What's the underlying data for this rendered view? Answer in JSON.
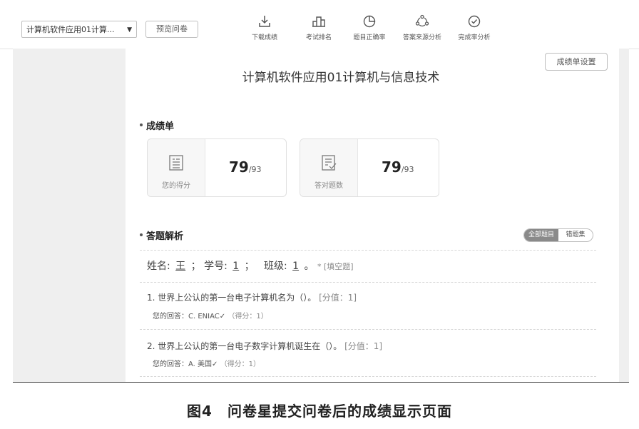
{
  "toolbar": {
    "select_value": "计算机软件应用01计算...",
    "preview_label": "预览问卷",
    "tools": [
      {
        "label": "下载成绩",
        "icon": "download-icon"
      },
      {
        "label": "考试排名",
        "icon": "ranking-icon"
      },
      {
        "label": "题目正确率",
        "icon": "pie-chart-icon"
      },
      {
        "label": "答案来源分析",
        "icon": "source-analysis-icon"
      },
      {
        "label": "完成率分析",
        "icon": "check-circle-icon"
      }
    ]
  },
  "settings_label": "成绩单设置",
  "page_title": "计算机软件应用01计算机与信息技术",
  "report": {
    "section_title": "成绩单",
    "cards": [
      {
        "label": "您的得分",
        "score": "79",
        "total": "/93",
        "icon": "score-sheet-icon"
      },
      {
        "label": "答对题数",
        "score": "79",
        "total": "/93",
        "icon": "correct-list-icon"
      }
    ]
  },
  "analysis": {
    "section_title": "答题解析",
    "toggle_all": "全部题目",
    "toggle_wrong": "错题集",
    "info": {
      "name_label": "姓名:",
      "name_value": "王",
      "sep1": "；",
      "id_label": "学号:",
      "id_value": "1",
      "sep2": "；",
      "class_label": "班级:",
      "class_value": "1",
      "end": "。",
      "tag": "* [填空题]"
    },
    "questions": [
      {
        "title": "1. 世界上公认的第一台电子计算机名为（）。",
        "value": "[分值：1]",
        "answer_label": "您的回答：",
        "answer": "C. ENIAC",
        "check": "✓",
        "score": "（得分：1）"
      },
      {
        "title": "2. 世界上公认的第一台电子数字计算机诞生在（）。",
        "value": "[分值：1]",
        "answer_label": "您的回答：",
        "answer": "A. 美国",
        "check": "✓",
        "score": "（得分：1）"
      }
    ]
  },
  "caption": "图4　问卷星提交问卷后的成绩显示页面",
  "colors": {
    "toggle_active": "#8a8a8a",
    "gutter": "#efefef"
  }
}
